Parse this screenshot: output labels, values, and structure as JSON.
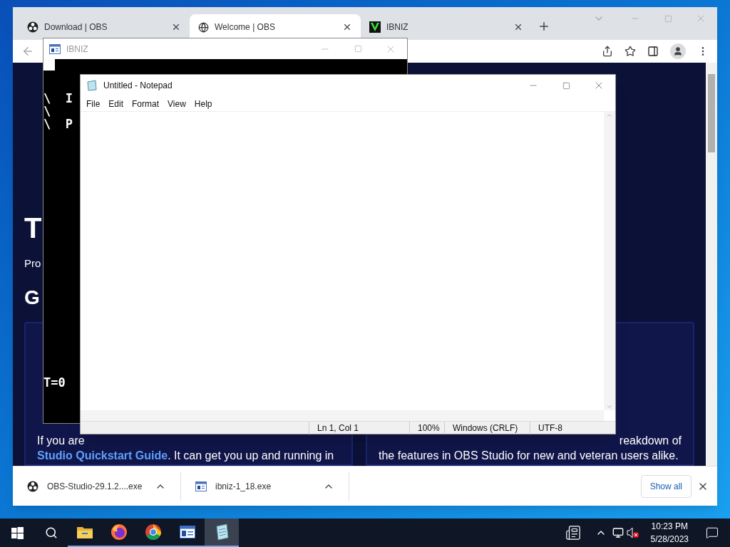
{
  "browser": {
    "tabs": [
      {
        "title": "Download | OBS",
        "kind": "obs",
        "selected": false
      },
      {
        "title": "Welcome | OBS",
        "kind": "globe",
        "selected": true
      },
      {
        "title": "IBNIZ",
        "kind": "ibniz",
        "selected": false
      }
    ],
    "page": {
      "heading": "T",
      "intro": "Pro",
      "section": "G",
      "cards": [
        {
          "first_line": "If you are",
          "link": "Studio Quickstart Guide",
          "rest": ". It can get you up and running in"
        },
        {
          "first_line": "reakdown of",
          "rest": "the features in OBS Studio for new and veteran users alike."
        }
      ]
    },
    "downloads": [
      {
        "name": "OBS-Studio-29.1.2....exe",
        "kind": "obs"
      },
      {
        "name": "ibniz-1_18.exe",
        "kind": "app"
      }
    ],
    "show_all": "Show all"
  },
  "ibniz": {
    "title": "IBNIZ",
    "lines": [
      "\\ I",
      "\\",
      "\\ P"
    ],
    "counter": "T=0"
  },
  "notepad": {
    "title": "Untitled - Notepad",
    "menu": [
      "File",
      "Edit",
      "Format",
      "View",
      "Help"
    ],
    "status": [
      "Ln 1, Col 1",
      "100%",
      "Windows (CRLF)",
      "UTF-8"
    ]
  },
  "taskbar": {
    "apps": [
      {
        "kind": "explorer",
        "active": false
      },
      {
        "kind": "firefox",
        "active": false
      },
      {
        "kind": "chrome",
        "active": false
      },
      {
        "kind": "app",
        "active": false
      },
      {
        "kind": "notepad",
        "active": true
      }
    ],
    "time": "10:23 PM",
    "date": "5/28/2023"
  }
}
